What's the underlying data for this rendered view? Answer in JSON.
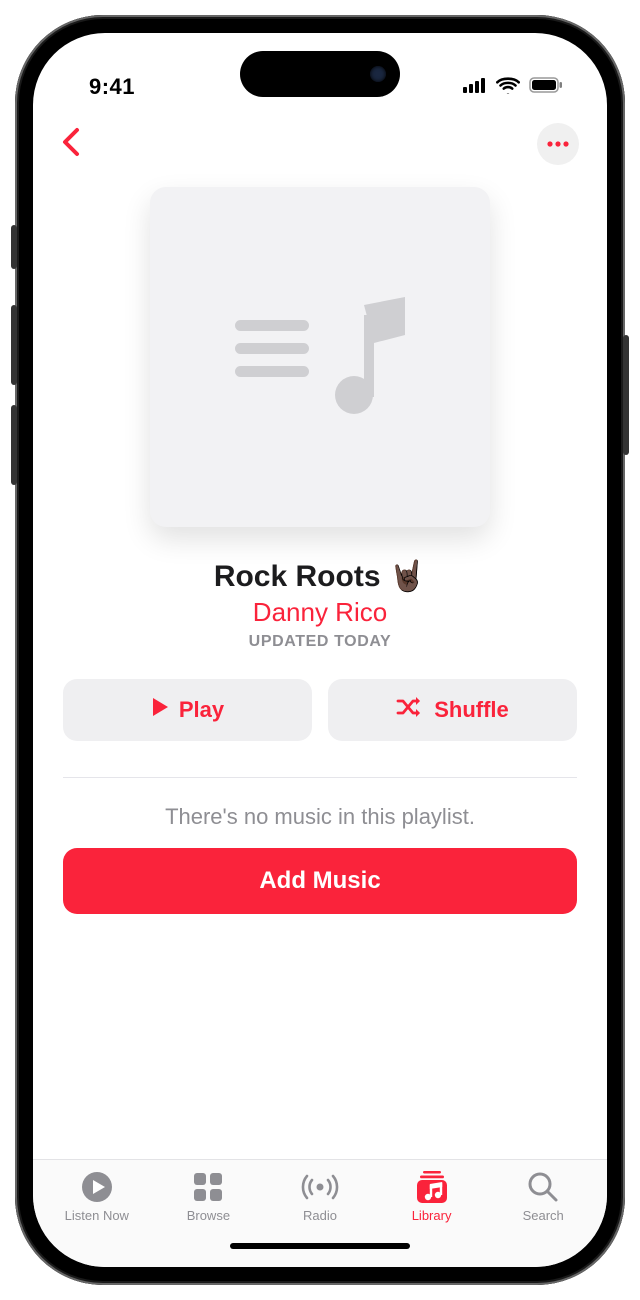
{
  "status": {
    "time": "9:41"
  },
  "playlist": {
    "title": "Rock Roots 🤘🏿",
    "author": "Danny Rico",
    "updated": "UPDATED TODAY"
  },
  "actions": {
    "play": "Play",
    "shuffle": "Shuffle"
  },
  "empty": {
    "message": "There's no music in this playlist.",
    "add_button": "Add Music"
  },
  "tabs": {
    "listen_now": "Listen Now",
    "browse": "Browse",
    "radio": "Radio",
    "library": "Library",
    "search": "Search"
  }
}
